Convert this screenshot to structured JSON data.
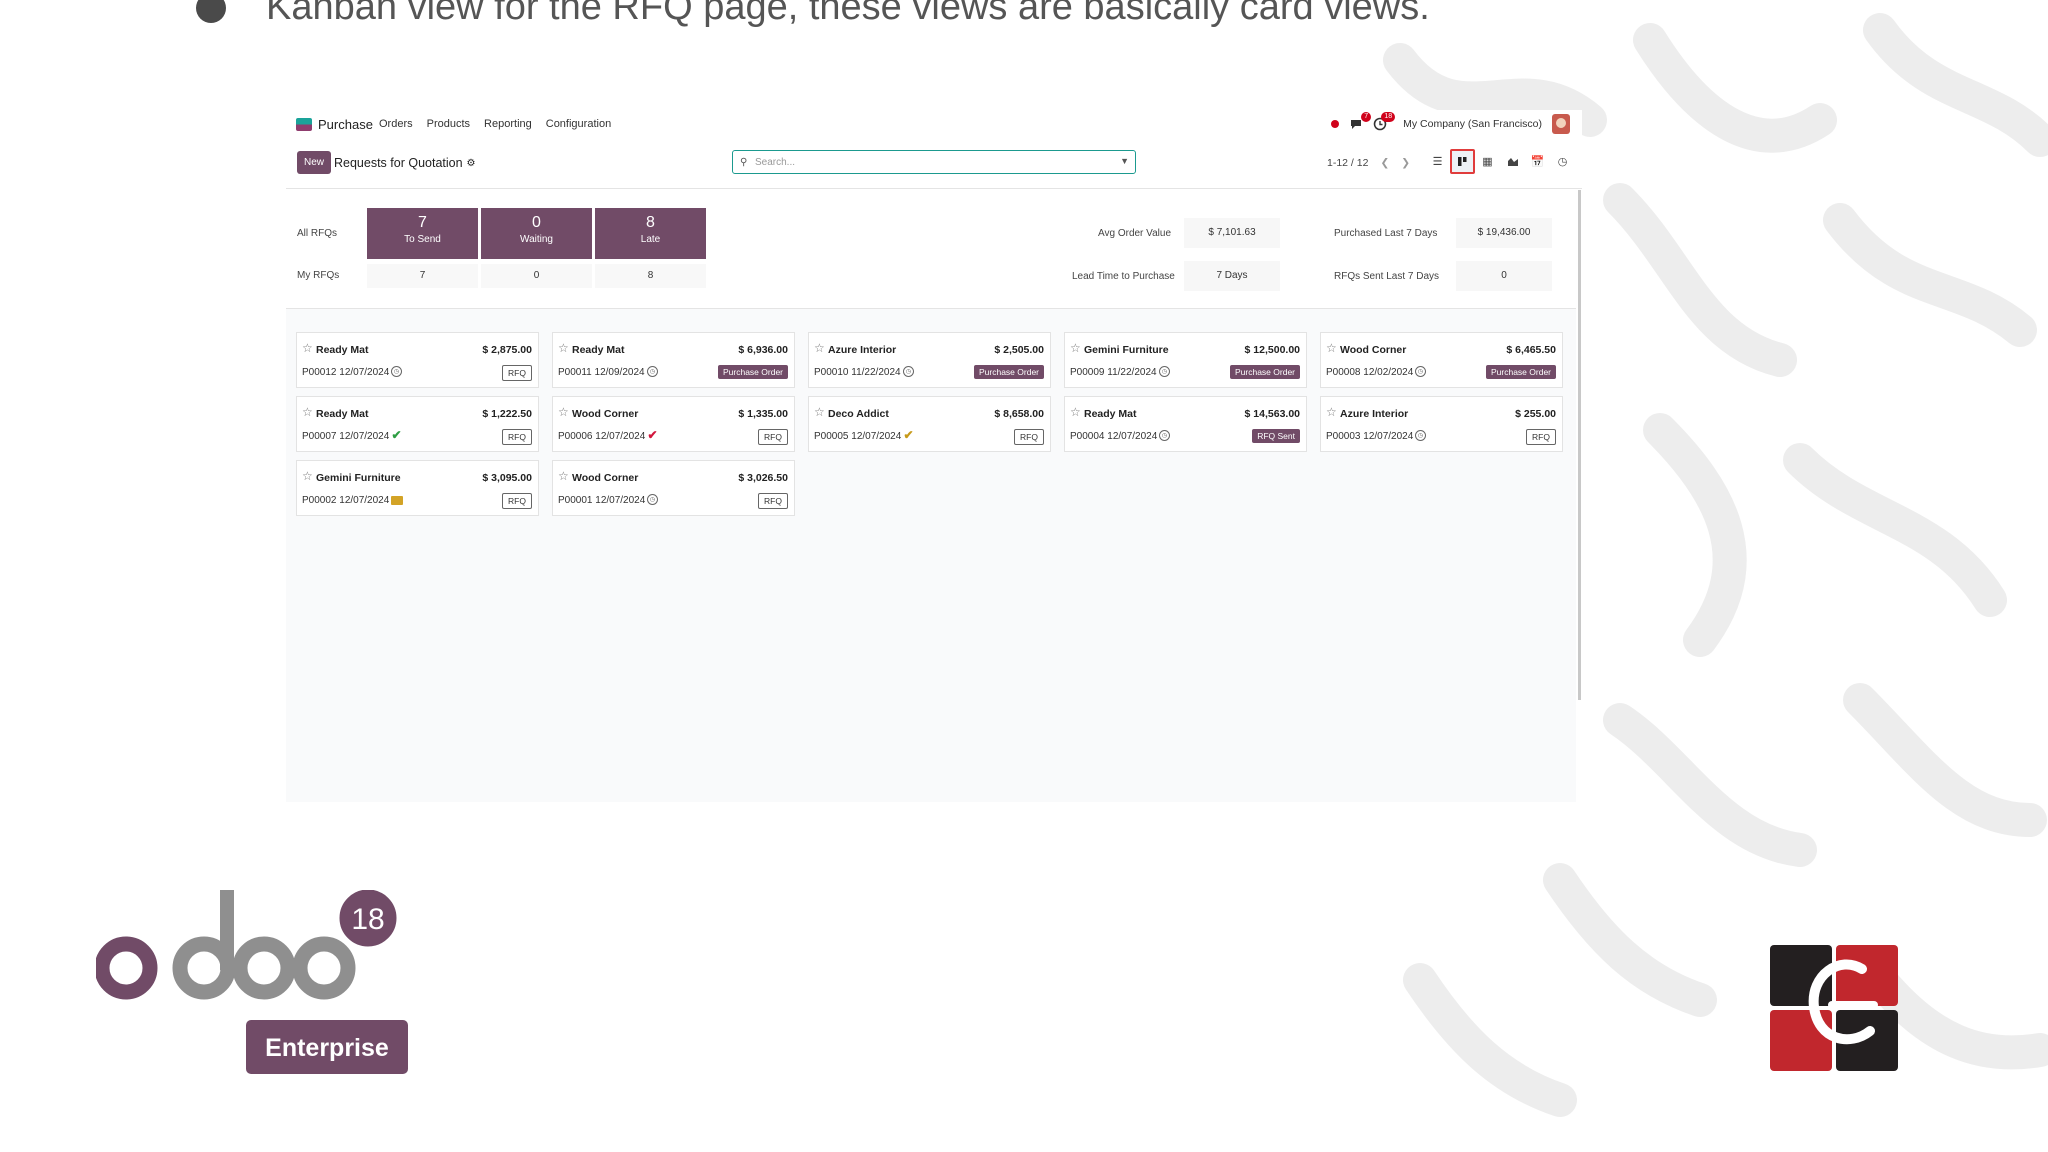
{
  "slide": {
    "bullet_text": "Kanban view for the RFQ page, these views are basically card views."
  },
  "app": {
    "brand": "Purchase",
    "menu": [
      "Orders",
      "Products",
      "Reporting",
      "Configuration"
    ],
    "messages_badge": "7",
    "activities_badge": "18",
    "company": "My Company (San Francisco)"
  },
  "control": {
    "new_label": "New",
    "title": "Requests for Quotation",
    "search_placeholder": "Search...",
    "pager": "1-12 / 12"
  },
  "views": [
    "list-view-icon",
    "kanban-view-icon",
    "pivot-view-icon",
    "graph-view-icon",
    "calendar-view-icon",
    "activity-view-icon"
  ],
  "dashboard": {
    "all_label": "All RFQs",
    "my_label": "My RFQs",
    "tiles": [
      {
        "count": "7",
        "label": "To Send",
        "mine": "7"
      },
      {
        "count": "0",
        "label": "Waiting",
        "mine": "0"
      },
      {
        "count": "8",
        "label": "Late",
        "mine": "8"
      }
    ],
    "stats": {
      "avg_order_label": "Avg Order Value",
      "avg_order_value": "$ 7,101.63",
      "purchased_label": "Purchased Last 7 Days",
      "purchased_value": "$ 19,436.00",
      "lead_time_label": "Lead Time to Purchase",
      "lead_time_value": "7 Days",
      "rfq_sent_label": "RFQs Sent Last 7 Days",
      "rfq_sent_value": "0"
    }
  },
  "cards": [
    {
      "vendor": "Ready Mat",
      "amount": "$ 2,875.00",
      "ref": "P00012 12/07/2024",
      "activity": "clock",
      "status": "RFQ",
      "status_type": "rfq"
    },
    {
      "vendor": "Ready Mat",
      "amount": "$ 6,936.00",
      "ref": "P00011 12/09/2024",
      "activity": "clock",
      "status": "Purchase Order",
      "status_type": "po"
    },
    {
      "vendor": "Azure Interior",
      "amount": "$ 2,505.00",
      "ref": "P00010 11/22/2024",
      "activity": "clock",
      "status": "Purchase Order",
      "status_type": "po"
    },
    {
      "vendor": "Gemini Furniture",
      "amount": "$ 12,500.00",
      "ref": "P00009 11/22/2024",
      "activity": "clock",
      "status": "Purchase Order",
      "status_type": "po"
    },
    {
      "vendor": "Wood Corner",
      "amount": "$ 6,465.50",
      "ref": "P00008 12/02/2024",
      "activity": "clock",
      "status": "Purchase Order",
      "status_type": "po"
    },
    {
      "vendor": "Ready Mat",
      "amount": "$ 1,222.50",
      "ref": "P00007 12/07/2024",
      "activity": "check",
      "status": "RFQ",
      "status_type": "rfq"
    },
    {
      "vendor": "Wood Corner",
      "amount": "$ 1,335.00",
      "ref": "P00006 12/07/2024",
      "activity": "checkred",
      "status": "RFQ",
      "status_type": "rfq"
    },
    {
      "vendor": "Deco Addict",
      "amount": "$ 8,658.00",
      "ref": "P00005 12/07/2024",
      "activity": "checkyel",
      "status": "RFQ",
      "status_type": "rfq"
    },
    {
      "vendor": "Ready Mat",
      "amount": "$ 14,563.00",
      "ref": "P00004 12/07/2024",
      "activity": "clock",
      "status": "RFQ Sent",
      "status_type": "sent"
    },
    {
      "vendor": "Azure Interior",
      "amount": "$ 255.00",
      "ref": "P00003 12/07/2024",
      "activity": "clock",
      "status": "RFQ",
      "status_type": "rfq"
    },
    {
      "vendor": "Gemini Furniture",
      "amount": "$ 3,095.00",
      "ref": "P00002 12/07/2024",
      "activity": "mail",
      "status": "RFQ",
      "status_type": "rfq"
    },
    {
      "vendor": "Wood Corner",
      "amount": "$ 3,026.50",
      "ref": "P00001 12/07/2024",
      "activity": "clock",
      "status": "RFQ",
      "status_type": "rfq"
    }
  ],
  "branding": {
    "odoo_version": "18",
    "edition": "Enterprise",
    "colors": {
      "odoo_purple": "#714b67",
      "odoo_grey": "#8f8f8f",
      "ce_red": "#c1272d",
      "ce_dark": "#231f20"
    }
  }
}
